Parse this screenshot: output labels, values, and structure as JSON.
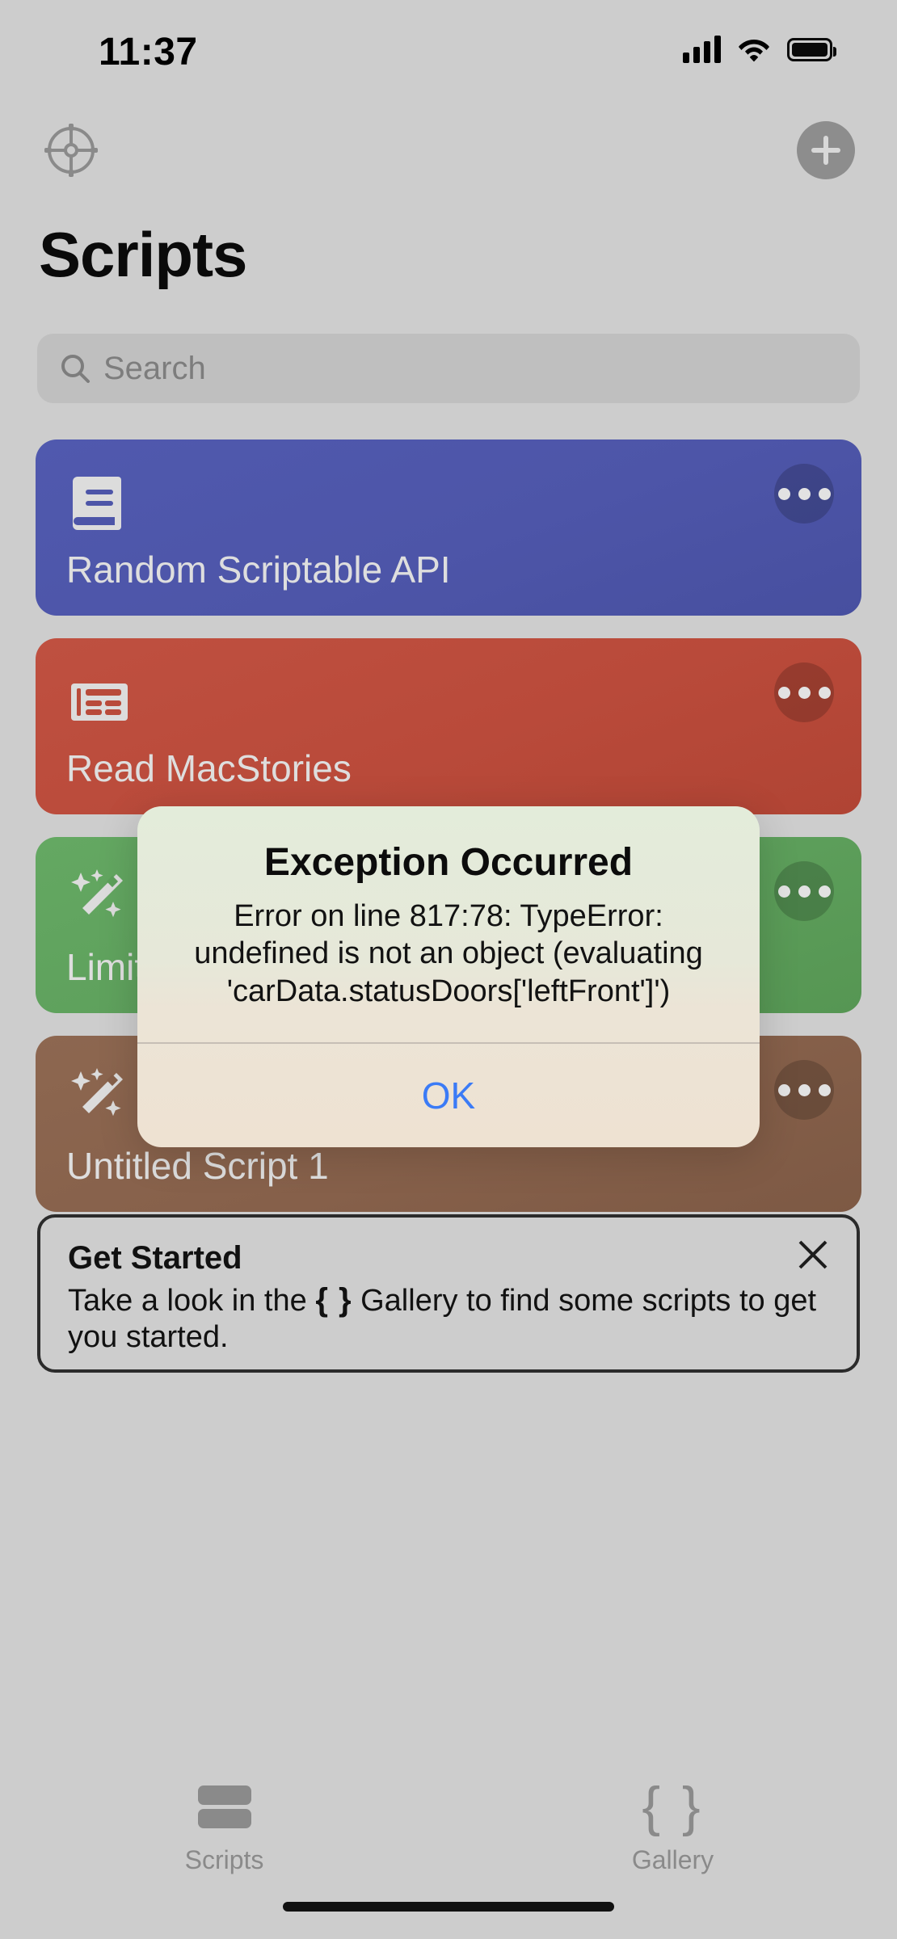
{
  "status_bar": {
    "time": "11:37",
    "icons": [
      "cellular-signal-icon",
      "wifi-icon",
      "battery-icon"
    ]
  },
  "nav_bar": {
    "settings_icon": "gear-icon",
    "add_icon": "plus-icon"
  },
  "header": {
    "title": "Scripts"
  },
  "search": {
    "placeholder": "Search",
    "value": "",
    "icon": "search-icon"
  },
  "scripts": [
    {
      "title": "Random Scriptable API",
      "color": "#4d55a8",
      "icon": "book-icon",
      "more_icon": "ellipsis-icon"
    },
    {
      "title": "Read MacStories",
      "color": "#b94a3a",
      "icon": "newspaper-icon",
      "more_icon": "ellipsis-icon"
    },
    {
      "title": "Limit",
      "color": "#5d9f5b",
      "icon": "magic-wand-icon",
      "more_icon": "ellipsis-icon"
    },
    {
      "title": "Untitled Script 1",
      "color": "#86604a",
      "icon": "magic-wand-icon",
      "more_icon": "ellipsis-icon"
    }
  ],
  "get_started": {
    "title": "Get Started",
    "body_before": "Take a look in the ",
    "braces": "{ }",
    "body_after": " Gallery to find some scripts to get you started.",
    "close_icon": "close-icon"
  },
  "alert": {
    "title": "Exception Occurred",
    "message": "Error on line 817:78: TypeError: undefined is not an object (evaluating 'carData.statusDoors['leftFront']')",
    "ok_label": "OK",
    "ok_color": "#3b7bf6"
  },
  "tab_bar": {
    "tabs": [
      {
        "label": "Scripts",
        "icon": "scripts-list-icon",
        "selected": true
      },
      {
        "label": "Gallery",
        "icon": "braces-icon",
        "selected": false
      }
    ]
  }
}
